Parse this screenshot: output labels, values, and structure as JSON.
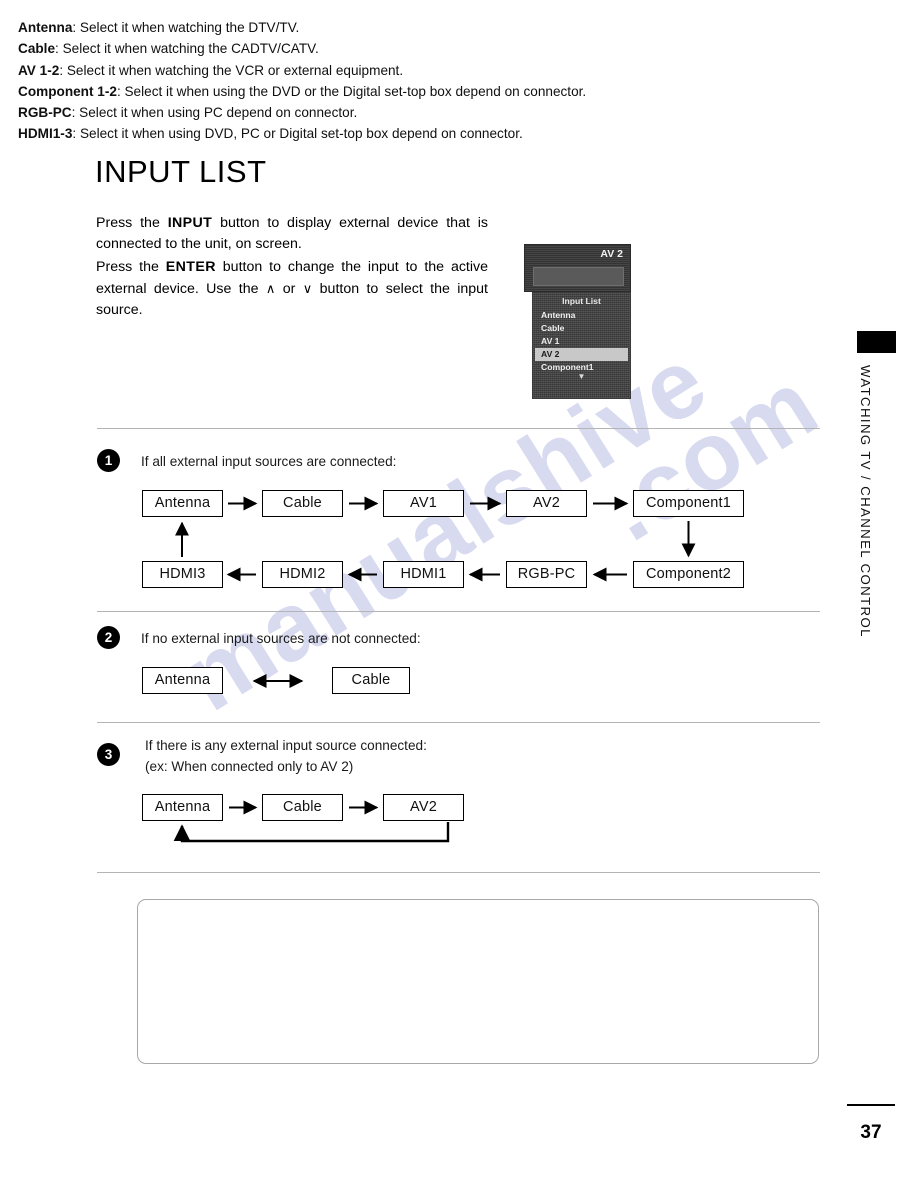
{
  "page": {
    "title": "INPUT LIST",
    "number": "37",
    "side_tab": "WATCHING TV / CHANNEL CONTROL",
    "watermark_left": "manualshive",
    "watermark_right": ".com"
  },
  "intro": {
    "line1_a": "Press the ",
    "line1_bold": "INPUT",
    "line1_b": " button to display external device that is connected to the unit, on screen.",
    "line2_a": "Press the ",
    "line2_bold": "ENTER",
    "line2_b": " button to change the input to the active external device. Use the ",
    "line2_caret_up": "∧",
    "line2_or": " or ",
    "line2_caret_down": "∨",
    "line2_c": " button to select the input source."
  },
  "tv": {
    "screen_label": "AV 2",
    "menu_title": "Input List",
    "menu_items": [
      {
        "label": "Antenna",
        "selected": false
      },
      {
        "label": "Cable",
        "selected": false
      },
      {
        "label": "AV 1",
        "selected": false
      },
      {
        "label": "AV 2",
        "selected": true
      },
      {
        "label": "Component1",
        "selected": false
      }
    ],
    "menu_more_arrow": "▼"
  },
  "steps": [
    {
      "number": "1",
      "caption": "If all external input sources are connected:",
      "row_top": [
        "Antenna",
        "Cable",
        "AV1",
        "AV2",
        "Component1"
      ],
      "row_bottom": [
        "HDMI3",
        "HDMI2",
        "HDMI1",
        "RGB-PC",
        "Component2"
      ]
    },
    {
      "number": "2",
      "caption": "If no external input sources are not connected:",
      "boxes": [
        "Antenna",
        "Cable"
      ]
    },
    {
      "number": "3",
      "caption": "If there is any external input source connected:",
      "caption2": "(ex: When connected only to AV 2)",
      "boxes": [
        "Antenna",
        "Cable",
        "AV2"
      ]
    }
  ],
  "legend": [
    {
      "term": "Antenna",
      "desc": ": Select it when watching the DTV/TV."
    },
    {
      "term": "Cable",
      "desc": ": Select it when watching the CADTV/CATV."
    },
    {
      "term": "AV 1-2",
      "desc": ": Select it when watching the VCR or external equipment."
    },
    {
      "term": "Component 1-2",
      "desc": ": Select it when using the DVD or the Digital set-top box depend on connector."
    },
    {
      "term": "RGB-PC",
      "desc": ": Select it when using PC depend on connector."
    },
    {
      "term": "HDMI1-3",
      "desc": ": Select it when using DVD, PC or Digital set-top box depend on connector."
    }
  ],
  "colors": {
    "ink": "#000000",
    "divider": "#b4b4b4",
    "watermark": "#b9bce4",
    "menu_highlight": "#c8c8c8"
  }
}
